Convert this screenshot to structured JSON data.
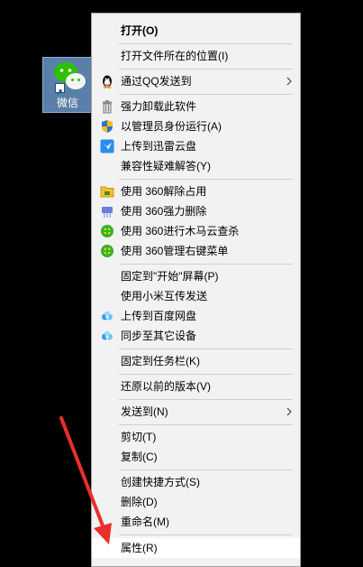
{
  "desktop_icon": {
    "label": "微信"
  },
  "menu": {
    "items": [
      {
        "label": "打开(O)"
      },
      {
        "label": "打开文件所在的位置(I)"
      },
      {
        "label": "通过QQ发送到"
      },
      {
        "label": "强力卸载此软件"
      },
      {
        "label": "以管理员身份运行(A)"
      },
      {
        "label": "上传到迅雷云盘"
      },
      {
        "label": "兼容性疑难解答(Y)"
      },
      {
        "label": "使用 360解除占用"
      },
      {
        "label": "使用 360强力删除"
      },
      {
        "label": "使用 360进行木马云查杀"
      },
      {
        "label": "使用 360管理右键菜单"
      },
      {
        "label": "固定到\"开始\"屏幕(P)"
      },
      {
        "label": "使用小米互传发送"
      },
      {
        "label": "上传到百度网盘"
      },
      {
        "label": "同步至其它设备"
      },
      {
        "label": "固定到任务栏(K)"
      },
      {
        "label": "还原以前的版本(V)"
      },
      {
        "label": "发送到(N)"
      },
      {
        "label": "剪切(T)"
      },
      {
        "label": "复制(C)"
      },
      {
        "label": "创建快捷方式(S)"
      },
      {
        "label": "删除(D)"
      },
      {
        "label": "重命名(M)"
      },
      {
        "label": "属性(R)"
      }
    ]
  },
  "colors": {
    "menu_background": "#f2f2f2",
    "highlight": "#ffffff",
    "annotation_arrow": "#e8302a",
    "wechat_green": "#2dc100"
  }
}
